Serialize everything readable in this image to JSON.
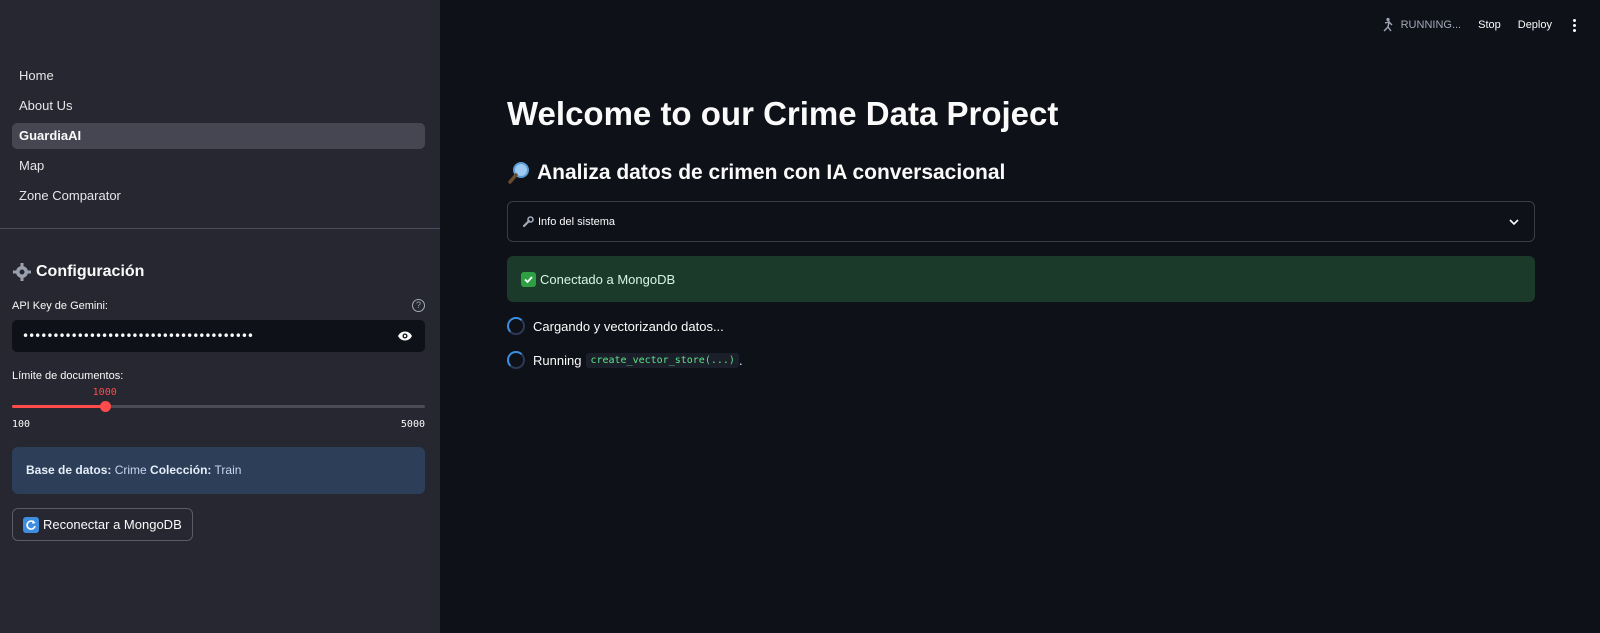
{
  "sidebar": {
    "nav": [
      {
        "label": "Home"
      },
      {
        "label": "About Us"
      },
      {
        "label": "GuardiaAI",
        "active": true
      },
      {
        "label": "Map"
      },
      {
        "label": "Zone Comparator"
      }
    ],
    "config_title": "Configuración",
    "api_key_label": "API Key de Gemini:",
    "api_key_value": "••••••••••••••••••••••••••••••••••••••",
    "limit_label": "Límite de documentos:",
    "slider": {
      "value": "1000",
      "min": "100",
      "max": "5000",
      "fraction": 0.2245
    },
    "db_info": {
      "db_label": "Base de datos:",
      "db_value": "Crime",
      "collection_label": "Colección:",
      "collection_value": "Train"
    },
    "reconnect_label": "Reconectar a MongoDB"
  },
  "header": {
    "status": "RUNNING...",
    "stop_label": "Stop",
    "deploy_label": "Deploy"
  },
  "main": {
    "title": "Welcome to our Crime Data Project",
    "subtitle": "Analiza datos de crimen con IA conversacional",
    "expander_label": "Info del sistema",
    "success_text": "Conectado a MongoDB",
    "loading_text": "Cargando y vectorizando datos...",
    "running_prefix": "Running",
    "running_code": "create_vector_store(...)",
    "running_suffix": "."
  },
  "colors": {
    "accent": "#ff4b4b",
    "background": "#0e1117",
    "sidebar": "#262730",
    "success": "#1b3a2a",
    "info": "#2c3e58"
  }
}
